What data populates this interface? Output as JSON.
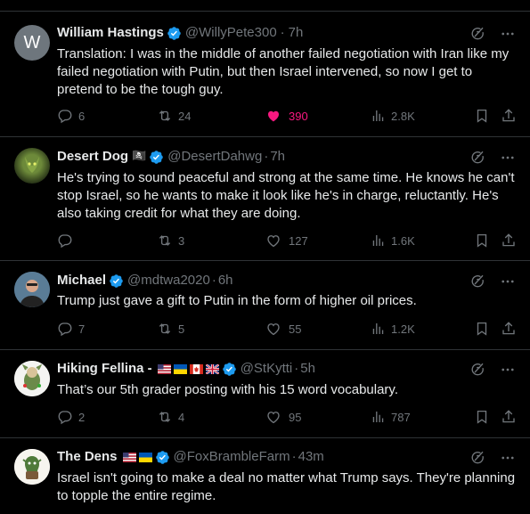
{
  "tweets": [
    {
      "name": "William Hastings",
      "handle": "@WillyPete300",
      "time": "7h",
      "avatar_letter": "W",
      "text": "Translation:  I was in the middle of another failed negotiation with Iran like my failed negotiation with Putin, but then Israel intervened, so now I get to pretend to be the tough guy.",
      "replies": "6",
      "reposts": "24",
      "likes": "390",
      "views": "2.8K",
      "liked": true
    },
    {
      "name": "Desert Dog",
      "name_emoji": "🏴‍☠️",
      "handle": "@DesertDahwg",
      "time": "7h",
      "text": "He's trying to sound peaceful and strong at the same time. He knows he can't stop Israel, so he wants to make it look like he's in charge, reluctantly. He's also taking credit for what they are doing.",
      "replies": "",
      "reposts": "3",
      "likes": "127",
      "views": "1.6K"
    },
    {
      "name": "Michael",
      "handle": "@mdtwa2020",
      "time": "6h",
      "text": "Trump just gave a gift to Putin in the form of higher oil prices.",
      "replies": "7",
      "reposts": "5",
      "likes": "55",
      "views": "1.2K"
    },
    {
      "name": "Hiking Fellina -",
      "handle": "@StKytti",
      "time": "5h",
      "flags": [
        "us",
        "ua",
        "ca",
        "uk"
      ],
      "text": "That’s our 5th grader posting with his 15 word vocabulary.",
      "replies": "2",
      "reposts": "4",
      "likes": "95",
      "views": "787"
    },
    {
      "name": "The Dens",
      "handle": "@FoxBrambleFarm",
      "time": "43m",
      "flags": [
        "us",
        "ua"
      ],
      "text": "Israel isn't going to make a deal no matter what Trump says. They're planning to topple the entire regime."
    }
  ],
  "ui": {
    "dot": "·",
    "icons": [
      "grok-icon",
      "more-icon",
      "reply-icon",
      "repost-icon",
      "like-icon",
      "views-icon",
      "bookmark-icon",
      "share-icon"
    ],
    "colors": {
      "verified": "#1d9bf0",
      "like_active": "#f91880",
      "muted": "#71767b",
      "border": "#2f3336"
    }
  }
}
